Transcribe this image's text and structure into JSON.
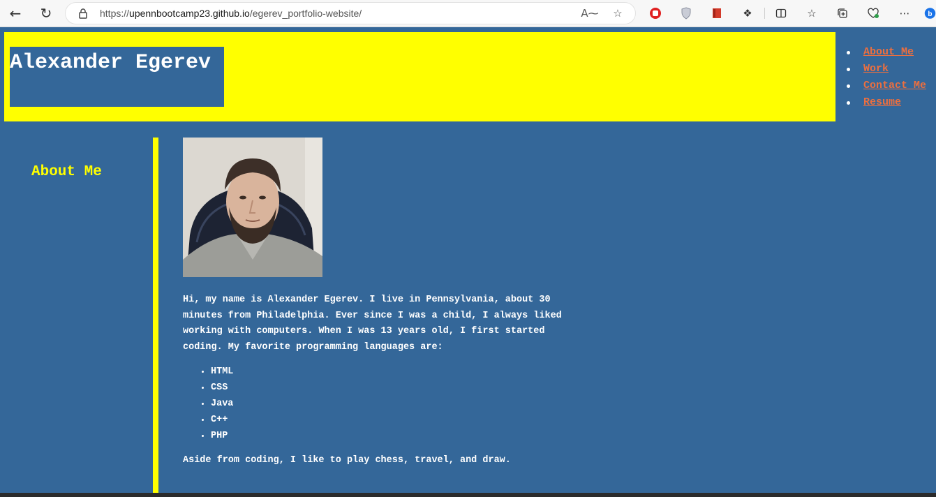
{
  "browser": {
    "url_prefix": "https://",
    "url_host": "upennbootcamp23.github.io",
    "url_path": "/egerev_portfolio-website/"
  },
  "header": {
    "site_title": "Alexander Egerev"
  },
  "nav": {
    "items": [
      {
        "label": "About Me"
      },
      {
        "label": "Work"
      },
      {
        "label": "Contact Me"
      },
      {
        "label": "Resume"
      }
    ]
  },
  "about": {
    "heading": "About Me",
    "intro": "Hi, my name is Alexander Egerev. I live in Pennsylvania, about 30 minutes from Philadelphia. Ever since I was a child, I always liked working with computers. When I was 13 years old, I first started coding. My favorite programming languages are:",
    "languages": [
      "HTML",
      "CSS",
      "Java",
      "C++",
      "PHP"
    ],
    "outro": "Aside from coding, I like to play chess, travel, and draw."
  },
  "colors": {
    "page_bg": "#346799",
    "header_bg": "#ffff00",
    "accent_yellow": "#ffff00",
    "link": "#ec6f3f",
    "text": "#ffffff"
  }
}
